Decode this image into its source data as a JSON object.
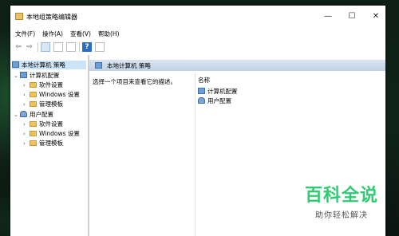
{
  "window": {
    "title": "本地组策略编辑器",
    "controls": {
      "minimize": "—",
      "maximize": "☐",
      "close": "✕"
    }
  },
  "menu": [
    {
      "label": "文件(F)"
    },
    {
      "label": "操作(A)"
    },
    {
      "label": "查看(V)"
    },
    {
      "label": "帮助(H)"
    }
  ],
  "toolbar": {
    "back": "⇦",
    "forward": "⇨",
    "help": "?"
  },
  "tree": {
    "root": "本地计算机 策略",
    "computer": "计算机配置",
    "computer_children": [
      "软件设置",
      "Windows 设置",
      "管理模板"
    ],
    "user": "用户配置",
    "user_children": [
      "软件设置",
      "Windows 设置",
      "管理模板"
    ]
  },
  "right_pane": {
    "header": "本地计算机 策略",
    "description": "选择一个项目来查看它的描述。",
    "column_name": "名称",
    "items": [
      "计算机配置",
      "用户配置"
    ]
  },
  "watermark": {
    "title": "百科全说",
    "subtitle": "助你轻松解决"
  }
}
